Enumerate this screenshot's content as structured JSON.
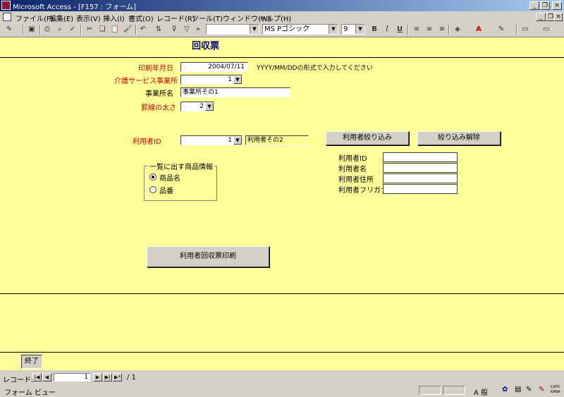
{
  "window": {
    "title": "Microsoft Access - [F157 : フォーム]"
  },
  "menu": [
    "ファイル(F)",
    "編集(E)",
    "表示(V)",
    "挿入(I)",
    "書式(O)",
    "レコード(R)",
    "ツール(T)",
    "ウィンドウ(W)",
    "ヘルプ(H)"
  ],
  "toolbar": {
    "font_name": "MS Pゴシック",
    "font_size": "9",
    "bold": "B",
    "italic": "I",
    "underline": "U"
  },
  "form": {
    "title": "回収票",
    "print_date_label": "印刷年月日",
    "print_date_value": "2004/07/11",
    "print_date_hint": "YYYY/MM/DDの形式で入力してください",
    "service_office_label": "介護サービス事業所",
    "service_office_value": "1",
    "office_name_label": "事業所名",
    "office_name_value": "事業所その1",
    "line_width_label": "罫線の太さ",
    "line_width_value": "2",
    "user_id_label": "利用者ID",
    "user_id_value": "1",
    "user_name_value": "利用者その2",
    "filter_button": "利用者絞り込み",
    "clear_filter_button": "絞り込み解除",
    "detail_labels": [
      "利用者ID",
      "利用者名",
      "利用者住所",
      "利用者フリガナ"
    ],
    "group_title": "一覧に出す商品情報",
    "radio_options": [
      "商品名",
      "品番"
    ],
    "radio_selected": 0,
    "print_button": "利用者回収票印刷",
    "exit_button": "終了"
  },
  "navigation": {
    "label": "レコード:",
    "current": "1",
    "total": "/ 1"
  },
  "status": {
    "view": "フォーム ビュー",
    "ime": "A 般",
    "caps": "CAPS",
    "kana": "KANA"
  }
}
